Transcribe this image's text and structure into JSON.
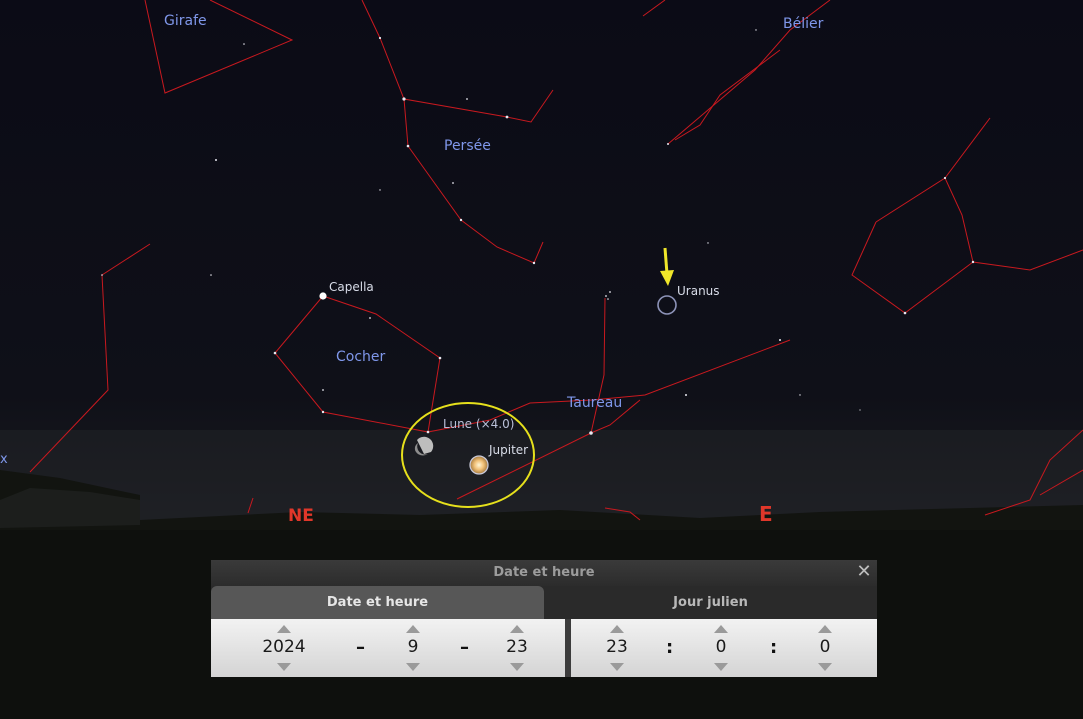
{
  "sky": {
    "constellations": {
      "girafe": "Girafe",
      "belier": "Bélier",
      "persee": "Persée",
      "cocher": "Cocher",
      "taureau": "Taureau"
    },
    "objects": {
      "capella": "Capella",
      "uranus": "Uranus",
      "lune": "Lune (×4.0)",
      "jupiter": "Jupiter",
      "edge_x": "x"
    },
    "cardinals": {
      "ne": "NE",
      "e": "E"
    },
    "colors": {
      "constellation_lines": "#c8191f",
      "constellation_labels": "#7f97ea",
      "cardinal_labels": "#e0372a",
      "highlight_circle": "#e6e01c",
      "pointer_arrow": "#f0e62a"
    }
  },
  "dialog": {
    "title": "Date et heure",
    "close_icon": "close-icon",
    "tabs": {
      "date": "Date et heure",
      "julian": "Jour julien"
    },
    "date": {
      "year": "2024",
      "month": "9",
      "day": "23",
      "separator": "–"
    },
    "time": {
      "hour": "23",
      "minute": "0",
      "second": "0",
      "separator": ":"
    }
  }
}
